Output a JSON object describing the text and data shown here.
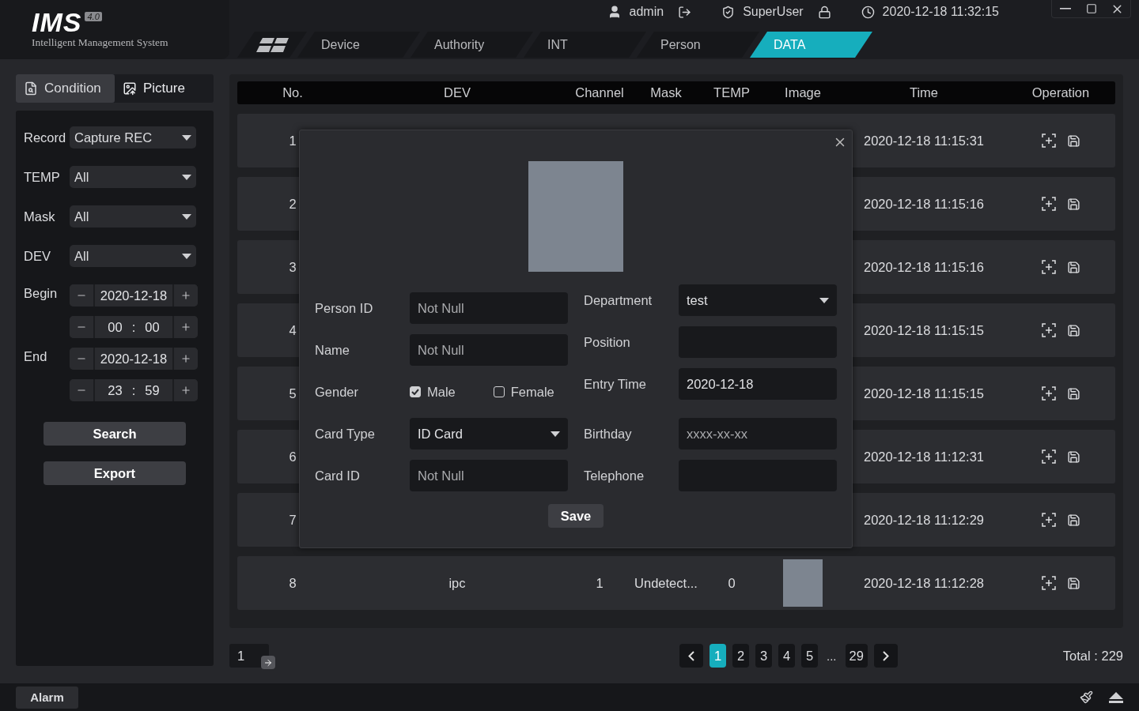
{
  "app": {
    "logo": "IMS",
    "version": "4.0",
    "subtitle": "Intelligent Management System"
  },
  "user": {
    "name": "admin",
    "role": "SuperUser",
    "datetime": "2020-12-18 11:32:15"
  },
  "tabs": [
    {
      "kind": "icon",
      "selected": false
    },
    {
      "kind": "text",
      "label": "Device",
      "selected": false
    },
    {
      "kind": "text",
      "label": "Authority",
      "selected": false
    },
    {
      "kind": "text",
      "label": "INT",
      "selected": false
    },
    {
      "kind": "text",
      "label": "Person",
      "selected": false
    },
    {
      "kind": "text",
      "label": "DATA",
      "selected": true
    }
  ],
  "side_tabs": [
    {
      "kind": "condition",
      "label": "Condition",
      "selected": true
    },
    {
      "kind": "picture",
      "label": "Picture",
      "selected": false
    }
  ],
  "filters": [
    {
      "label": "Record",
      "value": "Capture REC"
    },
    {
      "label": "TEMP",
      "value": "All"
    },
    {
      "label": "Mask",
      "value": "All"
    },
    {
      "label": "DEV",
      "value": "All"
    }
  ],
  "ranges": [
    {
      "label": "Begin",
      "date": "2020-12-18",
      "hour": "00",
      "separator": ":",
      "minute": "00"
    },
    {
      "label": "End",
      "date": "2020-12-18",
      "hour": "23",
      "separator": ":",
      "minute": "59"
    }
  ],
  "buttons": [
    "Search",
    "Export"
  ],
  "table": {
    "columns": [
      "No.",
      "DEV",
      "Channel",
      "Mask",
      "TEMP",
      "Image",
      "Time",
      "Operation"
    ],
    "rows": [
      {
        "no": "1",
        "time": "2020-12-18 11:15:31"
      },
      {
        "no": "2",
        "time": "2020-12-18 11:15:16"
      },
      {
        "no": "3",
        "time": "2020-12-18 11:15:16"
      },
      {
        "no": "4",
        "time": "2020-12-18 11:15:15"
      },
      {
        "no": "5",
        "time": "2020-12-18 11:15:15"
      },
      {
        "no": "6",
        "time": "2020-12-18 11:12:31"
      },
      {
        "no": "7",
        "time": "2020-12-18 11:12:29"
      },
      {
        "no": "8",
        "dev": "ipc",
        "channel": "1",
        "mask": "Undetect...",
        "temp": "0",
        "time": "2020-12-18 11:12:28"
      }
    ]
  },
  "pagination": {
    "page_input": "1",
    "pages": [
      {
        "kind": "page",
        "label": "1",
        "selected": true
      },
      {
        "kind": "page",
        "label": "2",
        "selected": false
      },
      {
        "kind": "page",
        "label": "3",
        "selected": false
      },
      {
        "kind": "page",
        "label": "4",
        "selected": false
      },
      {
        "kind": "page",
        "label": "5",
        "selected": false
      },
      {
        "kind": "ellipsis",
        "label": "..."
      },
      {
        "kind": "page",
        "label": "29",
        "selected": false
      }
    ],
    "total": "Total : 229"
  },
  "dialog": {
    "left": [
      {
        "kind": "input",
        "label": "Person ID",
        "placeholder": "Not Null"
      },
      {
        "kind": "input",
        "label": "Name",
        "placeholder": "Not Null"
      },
      {
        "kind": "radio",
        "label": "Gender",
        "options": [
          {
            "label": "Male",
            "checked": true
          },
          {
            "label": "Female",
            "checked": false
          }
        ]
      },
      {
        "kind": "select",
        "label": "Card Type",
        "value": "ID Card"
      },
      {
        "kind": "input",
        "label": "Card ID",
        "placeholder": "Not Null"
      }
    ],
    "right": [
      {
        "kind": "select",
        "label": "Department",
        "value": "test"
      },
      {
        "kind": "input",
        "label": "Position"
      },
      {
        "kind": "input",
        "label": "Entry Time",
        "value": "2020-12-18"
      },
      {
        "kind": "input",
        "label": "Birthday",
        "placeholder": "xxxx-xx-xx"
      },
      {
        "kind": "input",
        "label": "Telephone"
      }
    ],
    "save": "Save"
  },
  "status_bar": {
    "alarm": "Alarm"
  }
}
